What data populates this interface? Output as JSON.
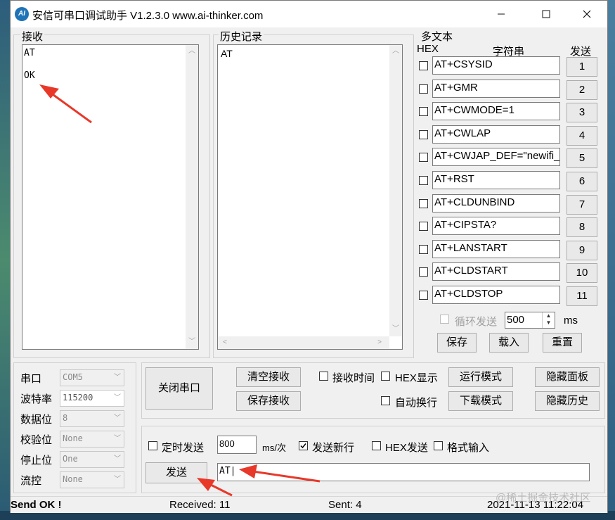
{
  "window": {
    "title": "安信可串口调试助手 V1.2.3.0    www.ai-thinker.com",
    "icon_text": "AI",
    "controls": [
      "minimize-icon",
      "maximize-icon",
      "close-icon"
    ]
  },
  "receive": {
    "label": "接收",
    "lines": [
      "AT",
      "OK"
    ]
  },
  "history": {
    "label": "历史记录",
    "lines": [
      "AT"
    ]
  },
  "multi_text": {
    "label": "多文本",
    "hex_header": "HEX",
    "string_header": "字符串",
    "send_header": "发送",
    "rows": [
      {
        "text": "AT+CSYSID",
        "button": "1"
      },
      {
        "text": "AT+GMR",
        "button": "2"
      },
      {
        "text": "AT+CWMODE=1",
        "button": "3"
      },
      {
        "text": "AT+CWLAP",
        "button": "4"
      },
      {
        "text": "AT+CWJAP_DEF=\"newifi_",
        "button": "5"
      },
      {
        "text": "AT+RST",
        "button": "6"
      },
      {
        "text": "AT+CLDUNBIND",
        "button": "7"
      },
      {
        "text": "AT+CIPSTA?",
        "button": "8"
      },
      {
        "text": "AT+LANSTART",
        "button": "9"
      },
      {
        "text": "AT+CLDSTART",
        "button": "10"
      },
      {
        "text": "AT+CLDSTOP",
        "button": "11"
      }
    ],
    "loop_send_label": "循环发送",
    "loop_interval": "500",
    "loop_unit": "ms",
    "save_button": "保存",
    "load_button": "载入",
    "reset_button": "重置"
  },
  "serial_settings": {
    "port_label": "串口",
    "port_value": "COM5",
    "baud_label": "波特率",
    "baud_value": "115200",
    "databits_label": "数据位",
    "databits_value": "8",
    "parity_label": "校验位",
    "parity_value": "None",
    "stopbits_label": "停止位",
    "stopbits_value": "One",
    "flow_label": "流控",
    "flow_value": "None"
  },
  "controls": {
    "close_port_button": "关闭串口",
    "clear_receive_button": "清空接收",
    "save_receive_button": "保存接收",
    "receive_time_label": "接收时间",
    "hex_display_label": "HEX显示",
    "auto_newline_label": "自动换行",
    "run_mode_button": "运行模式",
    "download_mode_button": "下载模式",
    "hide_panel_button": "隐藏面板",
    "hide_history_button": "隐藏历史"
  },
  "send": {
    "timed_send_label": "定时发送",
    "interval_value": "800",
    "interval_unit": "ms/次",
    "send_newline_label": "发送新行",
    "send_newline_checked": true,
    "hex_send_label": "HEX发送",
    "format_input_label": "格式输入",
    "send_button": "发送",
    "input_value": "AT"
  },
  "status": {
    "message": "Send OK !",
    "received": "Received: 11",
    "sent": "Sent: 4",
    "datetime": "2021-11-13 11:22:04",
    "watermark": "@稀土掘金技术社区"
  }
}
